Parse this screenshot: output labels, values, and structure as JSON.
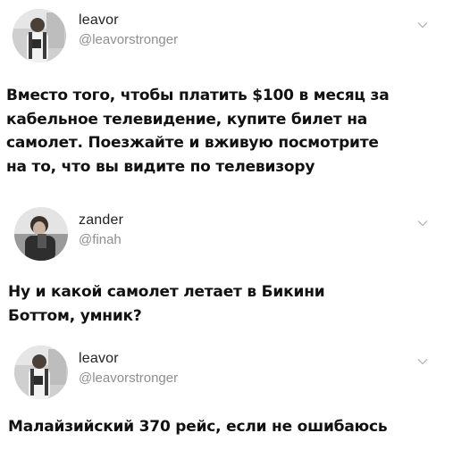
{
  "tweets": [
    {
      "display_name": "leavor",
      "handle": "@leavorstronger",
      "avatar_icon": "avatar-photo-leavor",
      "menu_icon": "chevron-down-icon",
      "text_lines": [
        "Вместо того, чтобы платить $100 в месяц за",
        "кабельное телевидение, купите билет на",
        "самолет. Поезжайте и вживую посмотрите",
        "на то, что вы видите по телевизору"
      ]
    },
    {
      "display_name": "zander",
      "handle": "@finah",
      "avatar_icon": "avatar-photo-zander",
      "menu_icon": "chevron-down-icon",
      "text_lines": [
        "Ну и какой самолет летает в Бикини",
        "Боттом, умник?"
      ]
    },
    {
      "display_name": "leavor",
      "handle": "@leavorstronger",
      "avatar_icon": "avatar-photo-leavor",
      "menu_icon": "chevron-down-icon",
      "text_lines": [
        "Малайзийский 370 рейс, если не ошибаюсь"
      ]
    }
  ],
  "colors": {
    "text": "#111111",
    "display_name": "#222222",
    "handle": "#8e8e8e",
    "chevron": "#b5b5b5",
    "background": "#ffffff"
  }
}
